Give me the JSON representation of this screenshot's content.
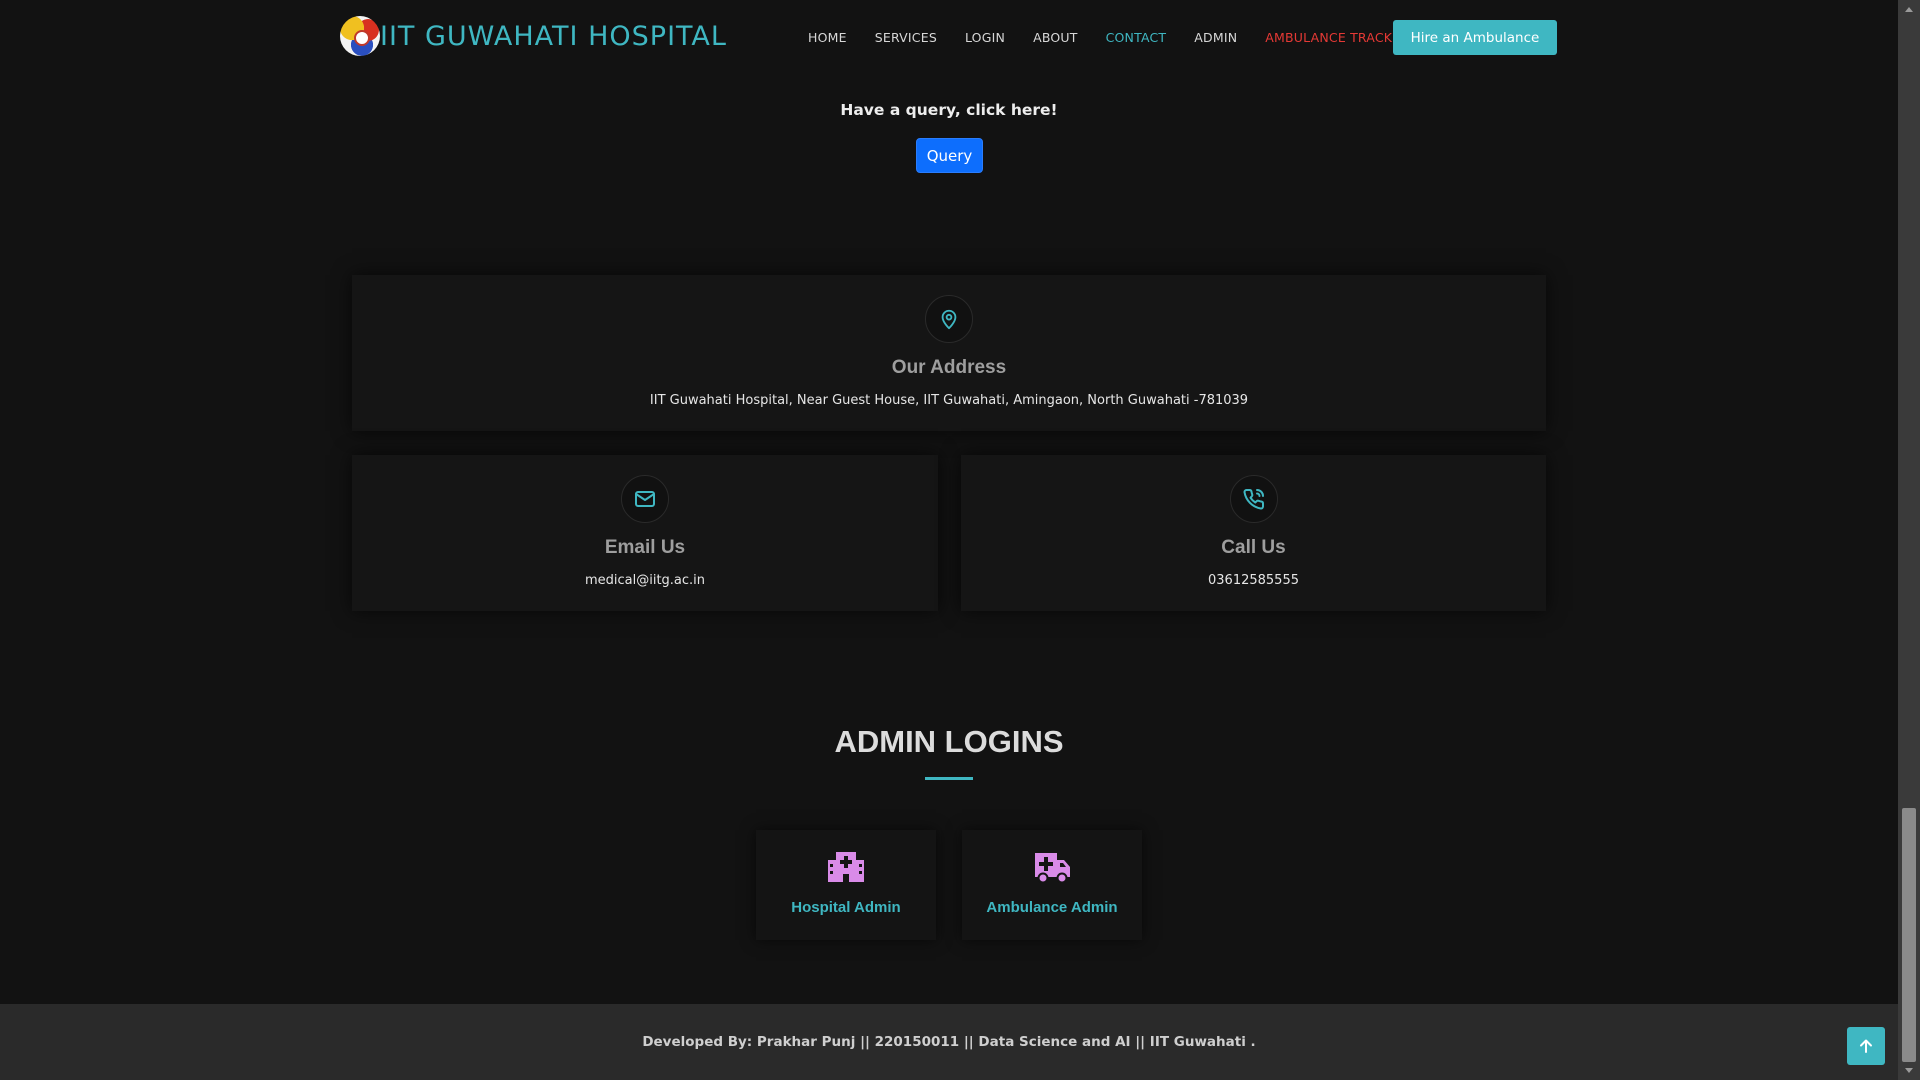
{
  "header": {
    "logo_text": "IIT GUWAHATI HOSPITAL",
    "nav": [
      {
        "label": "HOME"
      },
      {
        "label": "SERVICES"
      },
      {
        "label": "LOGIN"
      },
      {
        "label": "ABOUT"
      },
      {
        "label": "CONTACT"
      },
      {
        "label": "ADMIN"
      },
      {
        "label": "AMBULANCE TRACKING"
      }
    ],
    "active_item": "CONTACT",
    "cta_label": "Hire an Ambulance"
  },
  "query": {
    "prompt": "Have a query, click here!",
    "button_label": "Query"
  },
  "contact": {
    "address": {
      "icon": "map-pin-icon",
      "title": "Our Address",
      "text": "IIT Guwahati Hospital, Near Guest House, IIT Guwahati, Amingaon, North Guwahati -781039"
    },
    "email": {
      "icon": "envelope-icon",
      "title": "Email Us",
      "text": "medical@iitg.ac.in"
    },
    "phone": {
      "icon": "phone-icon",
      "title": "Call Us",
      "text": "03612585555"
    }
  },
  "admin_logins": {
    "title": "ADMIN LOGINS",
    "cards": [
      {
        "label": "Hospital Admin",
        "icon": "hospital-icon"
      },
      {
        "label": "Ambulance Admin",
        "icon": "ambulance-icon"
      }
    ]
  },
  "footer": {
    "text": "Developed By: Prakhar Punj || 220150011 || Data Science and AI || IIT Guwahati ."
  },
  "colors": {
    "accent": "#3fb7c2",
    "alert": "#e53935",
    "primary_button": "#0d6efd",
    "admin_icon": "#d98be8",
    "background": "#121212"
  }
}
